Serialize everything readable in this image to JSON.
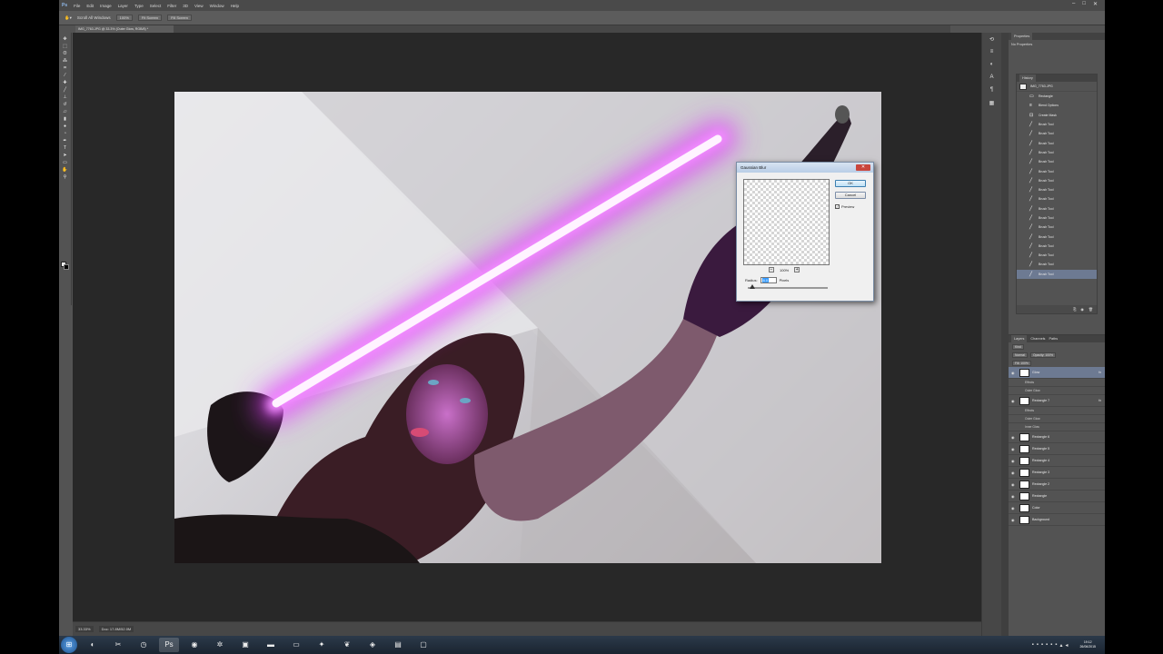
{
  "app": {
    "logo": "Ps"
  },
  "menu": [
    "File",
    "Edit",
    "Image",
    "Layer",
    "Type",
    "Select",
    "Filter",
    "3D",
    "View",
    "Window",
    "Help"
  ],
  "window_controls": [
    "–",
    "□",
    "✕"
  ],
  "options": {
    "tool": "Scroll All Windows",
    "buttons": [
      "100%",
      "Fit Screen",
      "Fill Screen"
    ]
  },
  "document": {
    "tab_title": "IMG_7763.JPG @ 33.3% (Outer Glow, RGB/8) *"
  },
  "status": {
    "zoom": "33.33%",
    "doc_info": "Doc: 17.8M/52.0M"
  },
  "properties": {
    "tab": "Properties",
    "empty_text": "No Properties"
  },
  "history": {
    "tab": "History",
    "snapshot": "IMG_7763.JPG",
    "items": [
      {
        "icon": "▭",
        "label": "Rectangle"
      },
      {
        "icon": "≡",
        "label": "Blend Options"
      },
      {
        "icon": "⊡",
        "label": "Create Mask"
      },
      {
        "icon": "╱",
        "label": "Brush Tool"
      },
      {
        "icon": "╱",
        "label": "Brush Tool"
      },
      {
        "icon": "╱",
        "label": "Brush Tool"
      },
      {
        "icon": "╱",
        "label": "Brush Tool"
      },
      {
        "icon": "╱",
        "label": "Brush Tool"
      },
      {
        "icon": "╱",
        "label": "Brush Tool"
      },
      {
        "icon": "╱",
        "label": "Brush Tool"
      },
      {
        "icon": "╱",
        "label": "Brush Tool"
      },
      {
        "icon": "╱",
        "label": "Brush Tool"
      },
      {
        "icon": "╱",
        "label": "Brush Tool"
      },
      {
        "icon": "╱",
        "label": "Brush Tool"
      },
      {
        "icon": "╱",
        "label": "Brush Tool"
      },
      {
        "icon": "╱",
        "label": "Brush Tool"
      },
      {
        "icon": "╱",
        "label": "Brush Tool"
      },
      {
        "icon": "╱",
        "label": "Brush Tool"
      },
      {
        "icon": "╱",
        "label": "Brush Tool"
      },
      {
        "icon": "╱",
        "label": "Brush Tool"
      }
    ]
  },
  "layers_panel": {
    "tabs": [
      "Layers",
      "Channels",
      "Paths"
    ],
    "kind": "Kind",
    "blend": "Normal",
    "opacity": "Opacity: 100%",
    "fill": "Fill: 100%",
    "layers": [
      {
        "name": "Glow",
        "selected": true,
        "fx": "fx"
      },
      {
        "name": "Effects",
        "sub": true
      },
      {
        "name": "Outer Glow",
        "sub": true
      },
      {
        "name": "Rectangle 7",
        "fx": "fx"
      },
      {
        "name": "Effects",
        "sub": true
      },
      {
        "name": "Outer Glow",
        "sub": true
      },
      {
        "name": "Inner Glow",
        "sub": true
      },
      {
        "name": "Rectangle 6"
      },
      {
        "name": "Rectangle 5"
      },
      {
        "name": "Rectangle 4"
      },
      {
        "name": "Rectangle 3"
      },
      {
        "name": "Rectangle 2"
      },
      {
        "name": "Rectangle"
      },
      {
        "name": "Color"
      },
      {
        "name": "Background"
      }
    ]
  },
  "dialog": {
    "title": "Gaussian Blur",
    "ok": "OK",
    "cancel": "Cancel",
    "preview_label": "Preview",
    "zoom": "100%",
    "radius_label": "Radius:",
    "radius_value": "6.0",
    "unit": "Pixels"
  },
  "taskbar": {
    "time": "19:12",
    "date": "26/06/2015"
  },
  "colors": {
    "glow": "#e040fb",
    "selection": "#6d7a92"
  }
}
